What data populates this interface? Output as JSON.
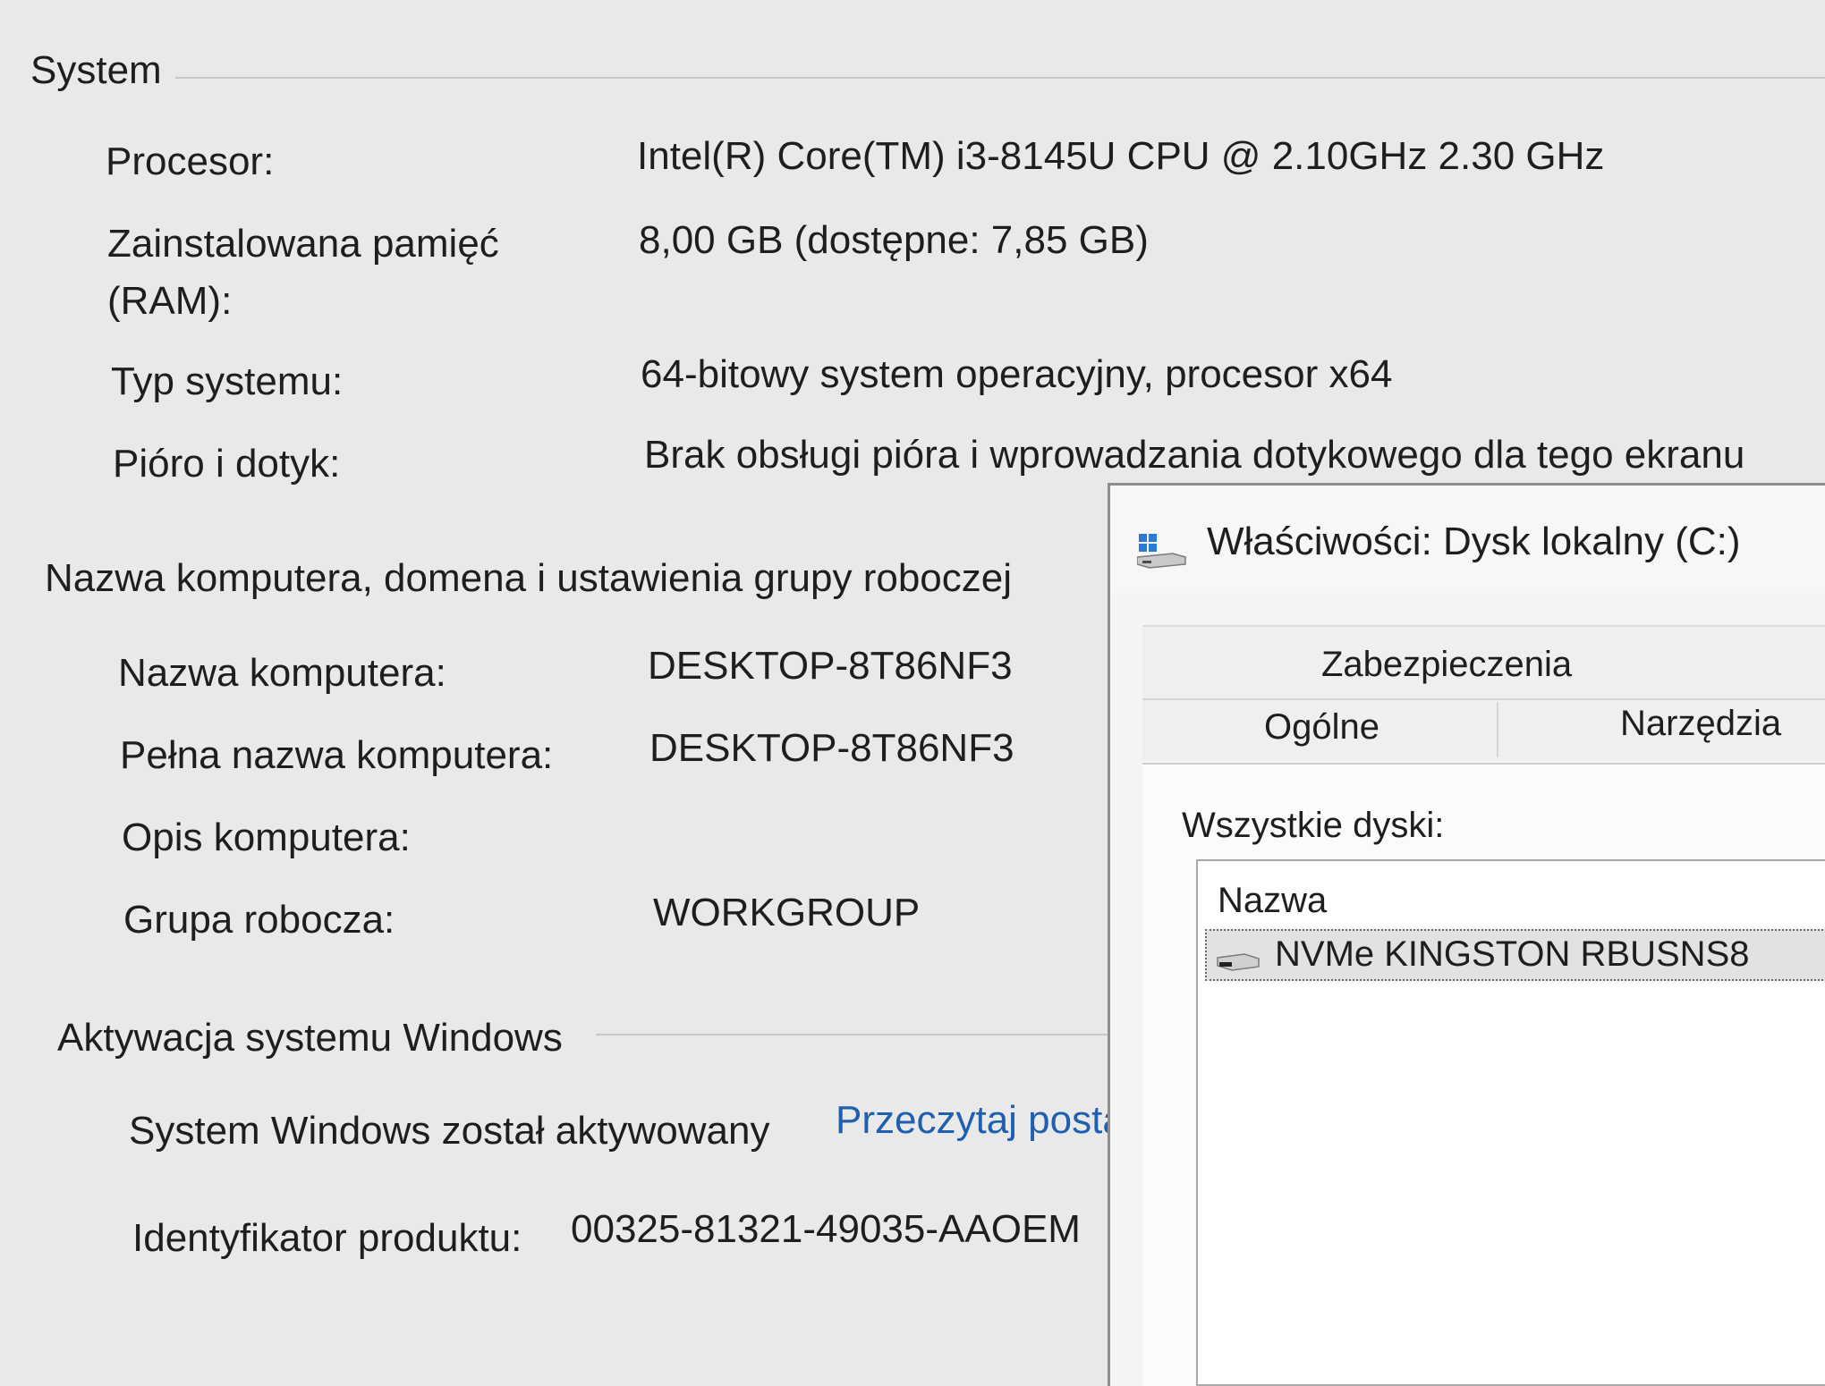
{
  "system": {
    "title": "System",
    "rows": [
      {
        "label": "Procesor:",
        "value": "Intel(R) Core(TM) i3-8145U CPU @ 2.10GHz   2.30 GHz"
      },
      {
        "label": "Zainstalowana pamięć",
        "label2": "(RAM):",
        "value": "8,00 GB (dostępne: 7,85 GB)"
      },
      {
        "label": "Typ systemu:",
        "value": "64-bitowy system operacyjny, procesor x64"
      },
      {
        "label": "Pióro i dotyk:",
        "value": "Brak obsługi pióra i wprowadzania dotykowego dla tego ekranu"
      }
    ]
  },
  "computer": {
    "title": "Nazwa komputera, domena i ustawienia grupy roboczej",
    "rows": [
      {
        "label": "Nazwa komputera:",
        "value": "DESKTOP-8T86NF3"
      },
      {
        "label": "Pełna nazwa komputera:",
        "value": "DESKTOP-8T86NF3"
      },
      {
        "label": "Opis komputera:",
        "value": ""
      },
      {
        "label": "Grupa robocza:",
        "value": "WORKGROUP"
      }
    ]
  },
  "activation": {
    "title": "Aktywacja systemu Windows",
    "status": "System Windows został aktywowany",
    "link": "Przeczytaj posta",
    "product_id_label": "Identyfikator produktu:",
    "product_id": "00325-81321-49035-AAOEM"
  },
  "dialog": {
    "title": "Właściwości: Dysk lokalny (C:)",
    "icon": "drive-icon",
    "tabs": {
      "security": "Zabezpieczenia",
      "general": "Ogólne",
      "tools": "Narzędzia"
    },
    "disks_label": "Wszystkie dyski:",
    "column_header": "Nazwa",
    "disk_name": "NVMe KINGSTON RBUSNS8"
  },
  "colors": {
    "link": "#1f5fb0",
    "background": "#e9e9e9"
  }
}
